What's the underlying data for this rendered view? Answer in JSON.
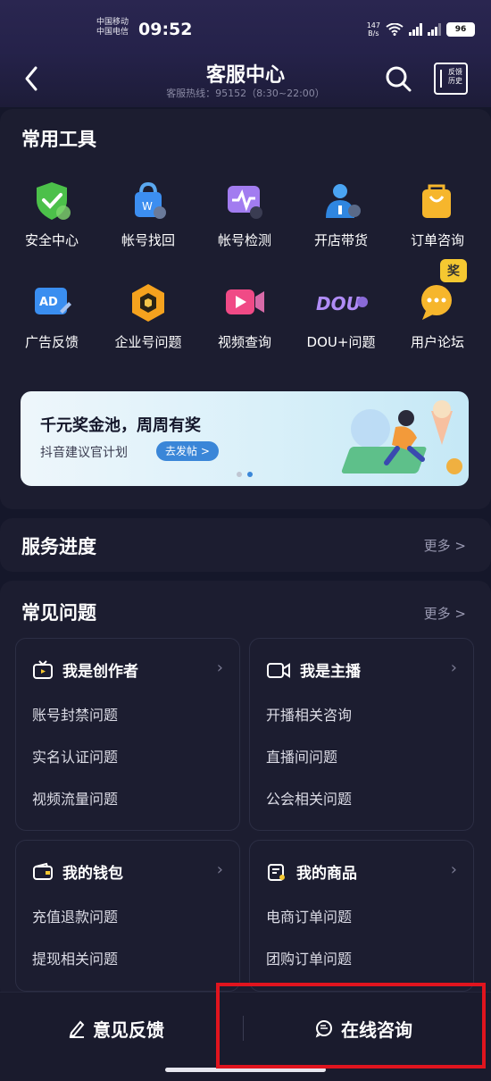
{
  "status_bar": {
    "carrier1": "中国移动",
    "carrier2": "中国电信",
    "time": "09:52",
    "net_speed": "147",
    "net_unit": "B/s",
    "battery": "96"
  },
  "header": {
    "title": "客服中心",
    "subtitle": "客服热线：95152（8:30~22:00）",
    "history_label": "反馈历史"
  },
  "tools": {
    "title": "常用工具",
    "items": [
      {
        "label": "安全中心",
        "icon": "shield-check-icon"
      },
      {
        "label": "帐号找回",
        "icon": "lock-bag-icon"
      },
      {
        "label": "帐号检测",
        "icon": "pulse-monitor-icon"
      },
      {
        "label": "开店带货",
        "icon": "shop-person-icon"
      },
      {
        "label": "订单咨询",
        "icon": "shopping-bag-icon"
      },
      {
        "label": "广告反馈",
        "icon": "ad-icon"
      },
      {
        "label": "企业号问题",
        "icon": "enterprise-hexagon-icon"
      },
      {
        "label": "视频查询",
        "icon": "video-camera-icon"
      },
      {
        "label": "DOU+问题",
        "icon": "dou-plus-icon"
      },
      {
        "label": "用户论坛",
        "icon": "chat-bubble-icon"
      }
    ],
    "forum_badge": "奖"
  },
  "banner": {
    "title": "千元奖金池，周周有奖",
    "subtitle": "抖音建议官计划",
    "button": "去发帖 >"
  },
  "progress": {
    "title": "服务进度",
    "more": "更多 >"
  },
  "faq": {
    "title": "常见问题",
    "more": "更多 >",
    "groups": [
      {
        "title": "我是创作者",
        "icon": "tv-icon",
        "items": [
          "账号封禁问题",
          "实名认证问题",
          "视频流量问题"
        ]
      },
      {
        "title": "我是主播",
        "icon": "camera-icon",
        "items": [
          "开播相关咨询",
          "直播间问题",
          "公会相关问题"
        ]
      },
      {
        "title": "我的钱包",
        "icon": "wallet-icon",
        "items": [
          "充值退款问题",
          "提现相关问题"
        ]
      },
      {
        "title": "我的商品",
        "icon": "goods-icon",
        "items": [
          "电商订单问题",
          "团购订单问题"
        ]
      }
    ]
  },
  "bottom": {
    "feedback": "意见反馈",
    "consult": "在线咨询"
  },
  "colors": {
    "background": "#15172a",
    "card": "#1c1d30",
    "highlight": "#e0141e",
    "accent_blue": "#3a86d8"
  }
}
